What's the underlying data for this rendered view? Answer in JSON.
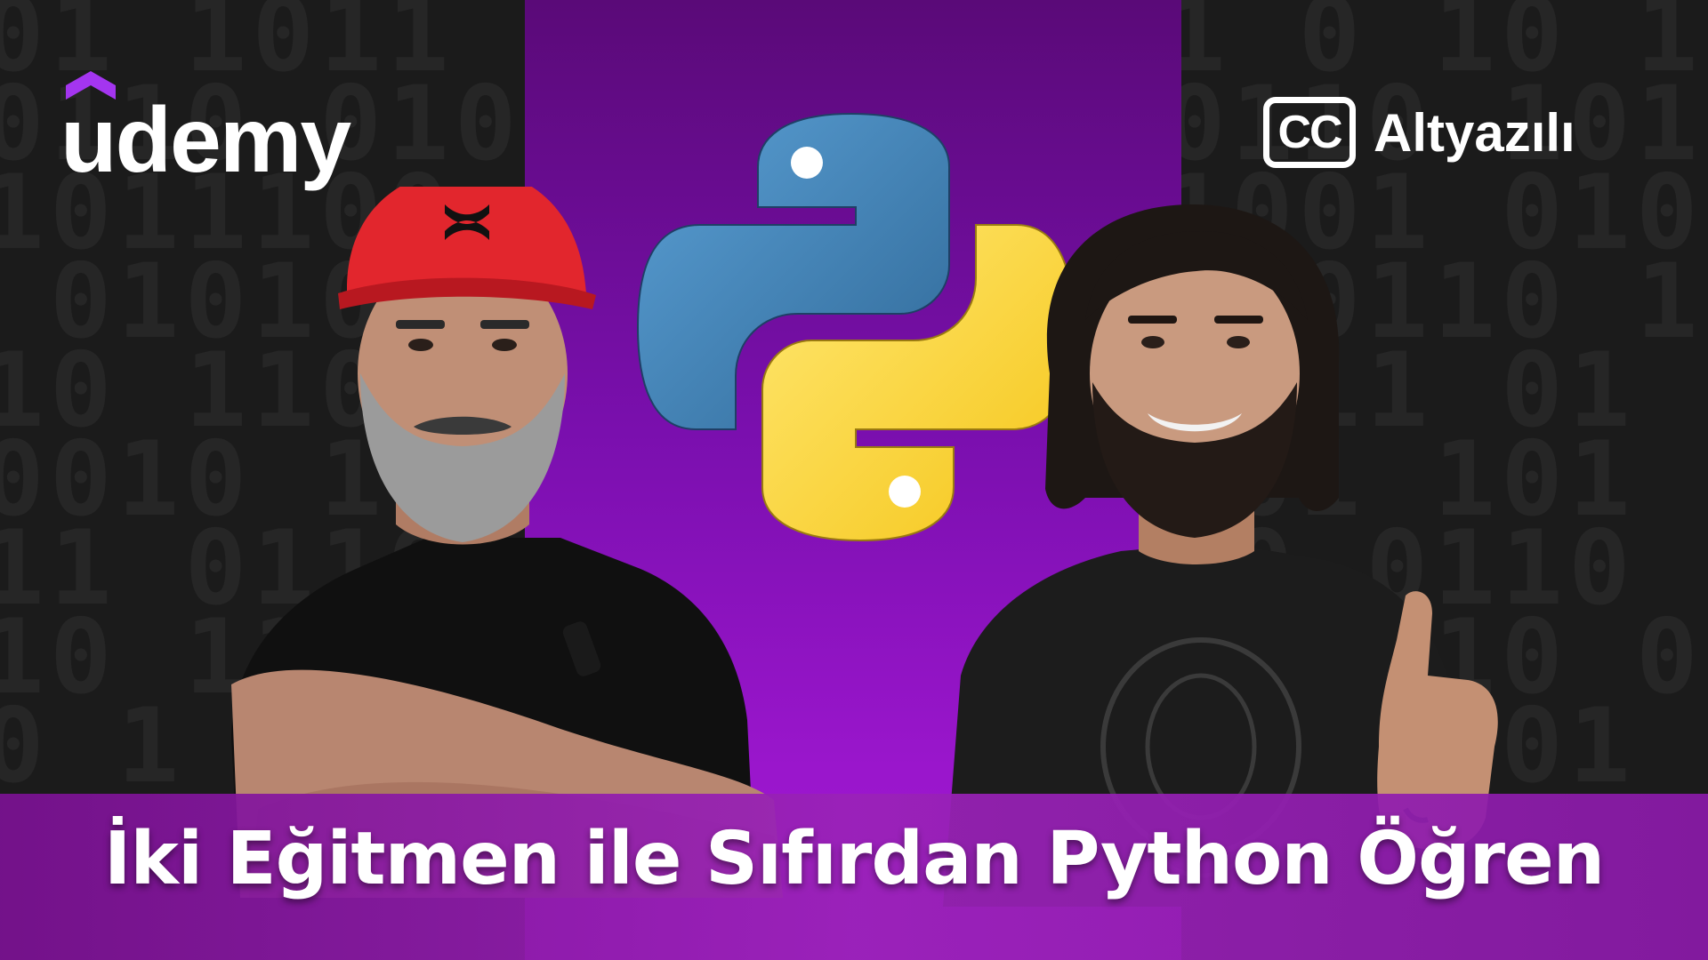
{
  "brand": {
    "name": "udemy",
    "accent_color": "#a435f0"
  },
  "badge": {
    "icon": "closed-captions-icon",
    "cc_text": "CC",
    "label": "Altyazılı"
  },
  "course": {
    "title": "İki Eğitmen ile Sıfırdan Python Öğren"
  },
  "graphic": {
    "center_icon": "python-logo-icon",
    "python_blue": "#3b74a8",
    "python_yellow": "#f7d64a",
    "center_purple": "#8a12be"
  }
}
